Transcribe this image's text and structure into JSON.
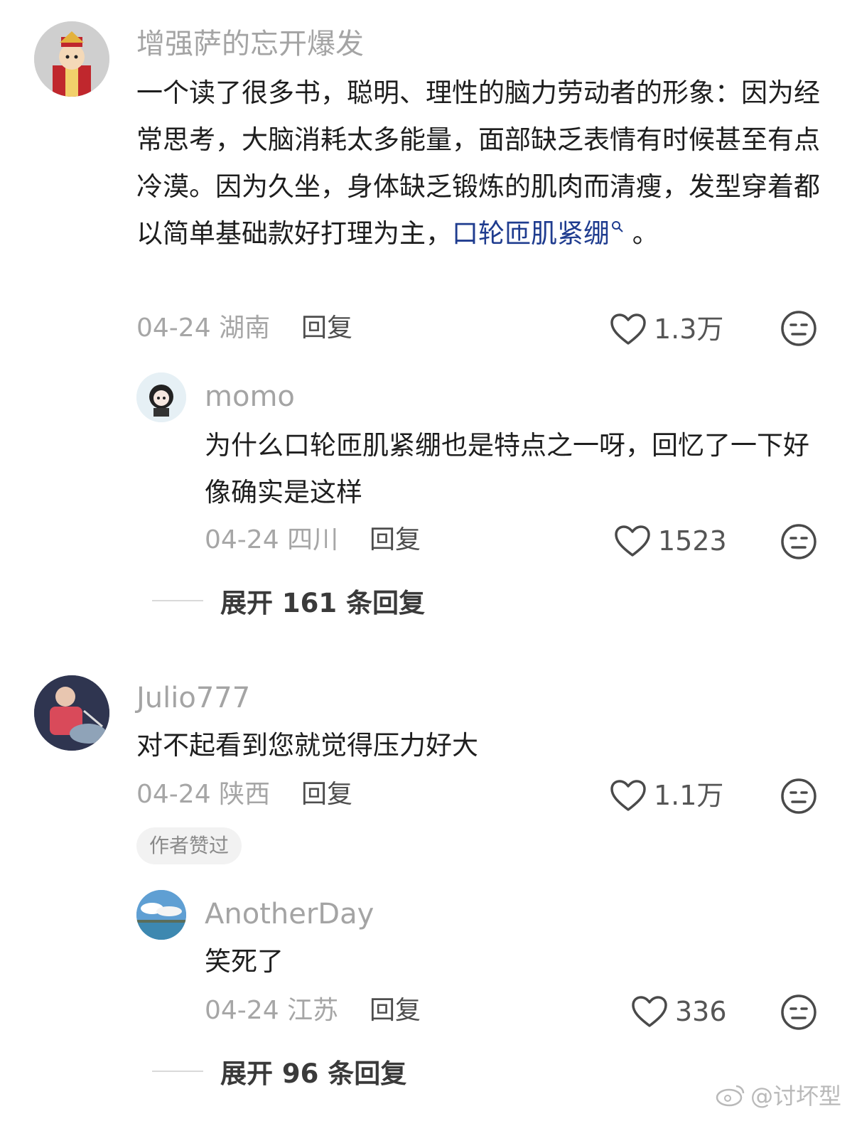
{
  "comments": [
    {
      "username": "增强萨的忘开爆发",
      "text": "一个读了很多书，聪明、理性的脑力劳动者的形象：因为经常思考，大脑消耗太多能量，面部缺乏表情有时候甚至有点冷漠。因为久坐，身体缺乏锻炼的肌肉而清瘦，发型穿着都以简单基础款好打理为主，",
      "tag": "口轮匝肌紧绷",
      "tag_suffix": "。",
      "date": "04-24",
      "location": "湖南",
      "reply_label": "回复",
      "likes": "1.3万",
      "replies": [
        {
          "username": "momo",
          "text": "为什么口轮匝肌紧绷也是特点之一呀，回忆了一下好像确实是这样",
          "date": "04-24",
          "location": "四川",
          "reply_label": "回复",
          "likes": "1523"
        }
      ],
      "expand_label": "展开 161 条回复"
    },
    {
      "username": "Julio777",
      "text": "对不起看到您就觉得压力好大",
      "date": "04-24",
      "location": "陕西",
      "reply_label": "回复",
      "likes": "1.1万",
      "author_badge": "作者赞过",
      "replies": [
        {
          "username": "AnotherDay",
          "text": "笑死了",
          "date": "04-24",
          "location": "江苏",
          "reply_label": "回复",
          "likes": "336"
        }
      ],
      "expand_label": "展开 96 条回复"
    }
  ],
  "watermark": "@讨坏型",
  "icons": {
    "like": "heart-icon",
    "dislike": "meh-face-icon",
    "search_tag": "search-icon",
    "watermark": "weibo-icon"
  },
  "colors": {
    "link": "#1f3c8f",
    "meta": "#a6a6a6",
    "username": "#a4a4a4"
  }
}
